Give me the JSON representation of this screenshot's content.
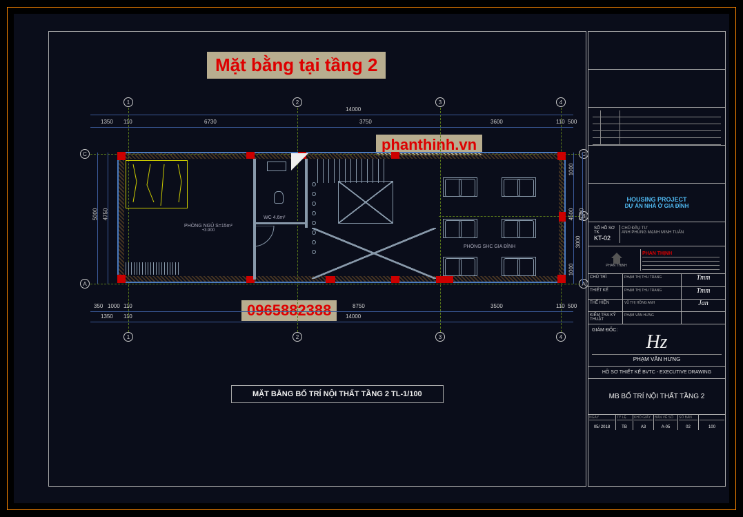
{
  "overlay": {
    "title": "Mặt bằng tại tầng 2",
    "website": "phanthinh.vn",
    "phone": "0965882388"
  },
  "drawing": {
    "title": "MẶT BẰNG BỐ TRÍ NỘI THẤT TẦNG 2 TL-1/100",
    "rooms": {
      "bedroom_label": "PHÒNG NGỦ",
      "bedroom_area": "S=15m²",
      "bedroom_level": "+3.900",
      "wc_label": "WC",
      "wc_area": "4.6m²",
      "family_label": "PHÒNG SHC GIA ĐÌNH"
    },
    "grids": {
      "col1": "1",
      "col2": "2",
      "col3": "3",
      "col4": "4",
      "rowA": "A",
      "rowB": "B",
      "rowC": "C"
    },
    "dims_top": {
      "seg1": "1350",
      "seg2": "110",
      "seg3": "6730",
      "seg4": "3750",
      "seg5": "3600",
      "seg6": "110",
      "seg7": "500",
      "total": "14000"
    },
    "dims_bottom": {
      "seg1": "350",
      "seg2": "1000",
      "seg3": "110",
      "seg4": "8750",
      "seg5": "3500",
      "seg6": "110",
      "seg7": "500",
      "sub1": "1350",
      "sub2": "110",
      "total": "14000"
    },
    "dims_left": {
      "seg1": "4750",
      "total": "5000"
    },
    "dims_right": {
      "seg1": "1000",
      "seg2": "4500",
      "seg3": "1000",
      "seg4": "3000",
      "total": "5000"
    }
  },
  "titleblock": {
    "project_en": "HOUSING PROJECT",
    "project_vn": "DỰ ÁN NHÀ Ở GIA ĐÌNH",
    "sheet_no_label": "SỐ HỒ SƠ TK",
    "sheet_no": "KT-02",
    "client_label": "CHỦ ĐẦU TƯ",
    "client_name": "ANH PHÙNG MẠNH MINH TUẤN",
    "logo_text": "PHAN THỊNH",
    "brand": "PHAN THỊNH",
    "roles": {
      "chu_tri": "CHỦ TRÌ",
      "chu_tri_name": "PHẠM THỊ THU TRANG",
      "thiet_ke": "THIẾT KẾ",
      "thiet_ke_name": "PHẠM THỊ THU TRANG",
      "the_hien": "THỂ HIỆN",
      "the_hien_name": "VŨ THỊ HỒNG ANH",
      "ktkt": "KIỂM TRA KỸ THUẬT",
      "ktkt_name": "PHẠM VĂN HƯNG"
    },
    "director_label": "GIÁM ĐỐC:",
    "director_name": "PHẠM VĂN HƯNG",
    "exec_label": "HỒ SƠ THIẾT KẾ BVTC - EXECUTIVE DRAWING",
    "drawing_name": "MB BỐ TRÍ NỘI THẤT TẦNG 2",
    "footer": {
      "date_label": "NGÀY",
      "date": "05/ 2018",
      "scale_label": "TỶ LỆ",
      "scale": "TB",
      "size_label": "KHỔ GIẤY",
      "size": "A3",
      "sheet_label": "BẢN VẼ SỐ",
      "sheet": "A-05",
      "total_label": "SỐ BẢN",
      "total": "02",
      "pages": "100"
    }
  }
}
